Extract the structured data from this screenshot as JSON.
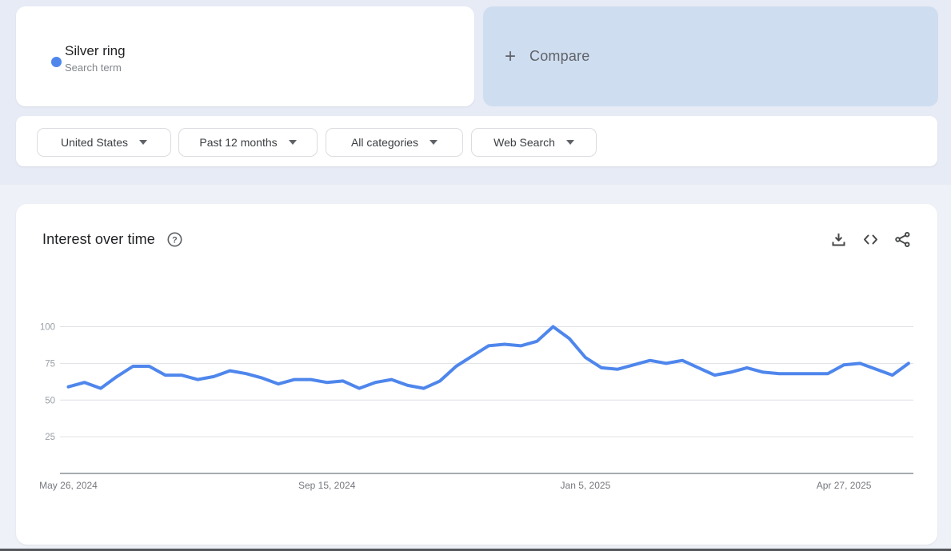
{
  "search_card": {
    "term": "Silver ring",
    "subtitle": "Search term",
    "dot_color": "#4e86ec"
  },
  "compare_card": {
    "plus": "+",
    "label": "Compare",
    "background": "#cfddf0"
  },
  "filters": [
    {
      "label": "United States"
    },
    {
      "label": "Past 12 months"
    },
    {
      "label": "All categories"
    },
    {
      "label": "Web Search"
    }
  ],
  "chart_card": {
    "title": "Interest over time",
    "icons": [
      "help-icon",
      "download-icon",
      "embed-icon",
      "share-icon"
    ]
  },
  "colors": {
    "accent_line": "#4e86ec",
    "page_top_band": "#e7ebf5",
    "page_background": "#eef1f8",
    "gridline": "#dfe1e5",
    "axis": "#8a8f96",
    "tick_text": "#9aa0a6",
    "xlabel_text": "#75787e",
    "icon": "#444746"
  },
  "chart_data": {
    "type": "line",
    "title": "Interest over time",
    "x": [
      "May 26, 2024",
      "Jun 2, 2024",
      "Jun 9, 2024",
      "Jun 16, 2024",
      "Jun 23, 2024",
      "Jun 30, 2024",
      "Jul 7, 2024",
      "Jul 14, 2024",
      "Jul 21, 2024",
      "Jul 28, 2024",
      "Aug 4, 2024",
      "Aug 11, 2024",
      "Aug 18, 2024",
      "Aug 25, 2024",
      "Sep 1, 2024",
      "Sep 8, 2024",
      "Sep 15, 2024",
      "Sep 22, 2024",
      "Sep 29, 2024",
      "Oct 6, 2024",
      "Oct 13, 2024",
      "Oct 20, 2024",
      "Oct 27, 2024",
      "Nov 3, 2024",
      "Nov 10, 2024",
      "Nov 17, 2024",
      "Nov 24, 2024",
      "Dec 1, 2024",
      "Dec 8, 2024",
      "Dec 15, 2024",
      "Dec 22, 2024",
      "Dec 29, 2024",
      "Jan 5, 2025",
      "Jan 12, 2025",
      "Jan 19, 2025",
      "Jan 26, 2025",
      "Feb 2, 2025",
      "Feb 9, 2025",
      "Feb 16, 2025",
      "Feb 23, 2025",
      "Mar 2, 2025",
      "Mar 9, 2025",
      "Mar 16, 2025",
      "Mar 23, 2025",
      "Mar 30, 2025",
      "Apr 6, 2025",
      "Apr 13, 2025",
      "Apr 20, 2025",
      "Apr 27, 2025",
      "May 4, 2025",
      "May 11, 2025",
      "May 18, 2025",
      "May 25, 2025"
    ],
    "series": [
      {
        "name": "Silver ring",
        "color": "#4e86ec",
        "values": [
          59,
          62,
          58,
          66,
          73,
          73,
          67,
          67,
          64,
          66,
          70,
          68,
          65,
          61,
          64,
          64,
          62,
          63,
          58,
          62,
          64,
          60,
          58,
          63,
          73,
          80,
          87,
          88,
          87,
          90,
          100,
          92,
          79,
          72,
          71,
          74,
          77,
          75,
          77,
          72,
          67,
          69,
          72,
          69,
          68,
          68,
          68,
          68,
          74,
          75,
          71,
          67,
          75
        ]
      }
    ],
    "xticks": [
      {
        "label": "May 26, 2024",
        "index": 0
      },
      {
        "label": "Sep 15, 2024",
        "index": 16
      },
      {
        "label": "Jan 5, 2025",
        "index": 32
      },
      {
        "label": "Apr 27, 2025",
        "index": 48
      }
    ],
    "yticks": [
      100,
      75,
      50,
      25
    ],
    "ylim": [
      0,
      100
    ],
    "grid": true,
    "legend": "none"
  }
}
